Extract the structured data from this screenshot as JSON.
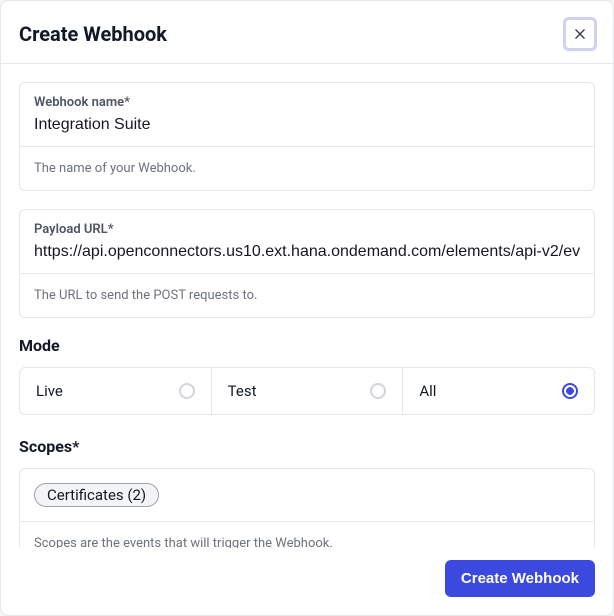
{
  "header": {
    "title": "Create Webhook"
  },
  "webhook_name": {
    "label": "Webhook name*",
    "value": "Integration Suite",
    "hint": "The name of your Webhook."
  },
  "payload_url": {
    "label": "Payload URL*",
    "value": "https://api.openconnectors.us10.ext.hana.ondemand.com/elements/api-v2/ev",
    "hint": "The URL to send the POST requests to."
  },
  "mode": {
    "title": "Mode",
    "options": [
      {
        "label": "Live",
        "selected": false
      },
      {
        "label": "Test",
        "selected": false
      },
      {
        "label": "All",
        "selected": true
      }
    ]
  },
  "scopes": {
    "title": "Scopes*",
    "chips": [
      "Certificates (2)"
    ],
    "hint": "Scopes are the events that will trigger the Webhook."
  },
  "footer": {
    "submit_label": "Create Webhook"
  }
}
